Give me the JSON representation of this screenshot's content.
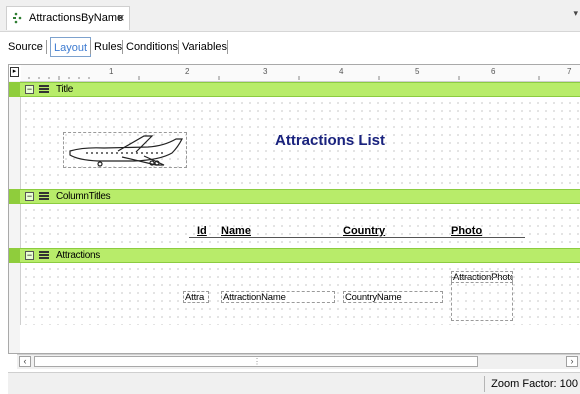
{
  "document_tab": {
    "title": "AttractionsByName",
    "close_glyph": "×"
  },
  "view_tabs": [
    {
      "label": "Source"
    },
    {
      "label": "Layout",
      "selected": true
    },
    {
      "label": "Rules"
    },
    {
      "label": "Conditions"
    },
    {
      "label": "Variables"
    }
  ],
  "ruler": {
    "numbers": [
      "1",
      "2",
      "3",
      "4",
      "5",
      "6",
      "7"
    ]
  },
  "printblocks": {
    "title": {
      "label": "Title",
      "report_title": "Attractions List",
      "image_icon": "airplane-image"
    },
    "column_titles": {
      "label": "ColumnTitles",
      "columns": [
        "Id",
        "Name",
        "Country",
        "Photo"
      ]
    },
    "attractions": {
      "label": "Attractions",
      "fields": {
        "id": "Attra",
        "name": "AttractionName",
        "country": "CountryName",
        "photo": "AttractionPhoto"
      }
    }
  },
  "status": {
    "zoom": "Zoom Factor: 100"
  },
  "colors": {
    "printblock_bar": "#b8ec6a",
    "title_text": "#1a237e",
    "selected_tab": "#3d7bd1"
  }
}
